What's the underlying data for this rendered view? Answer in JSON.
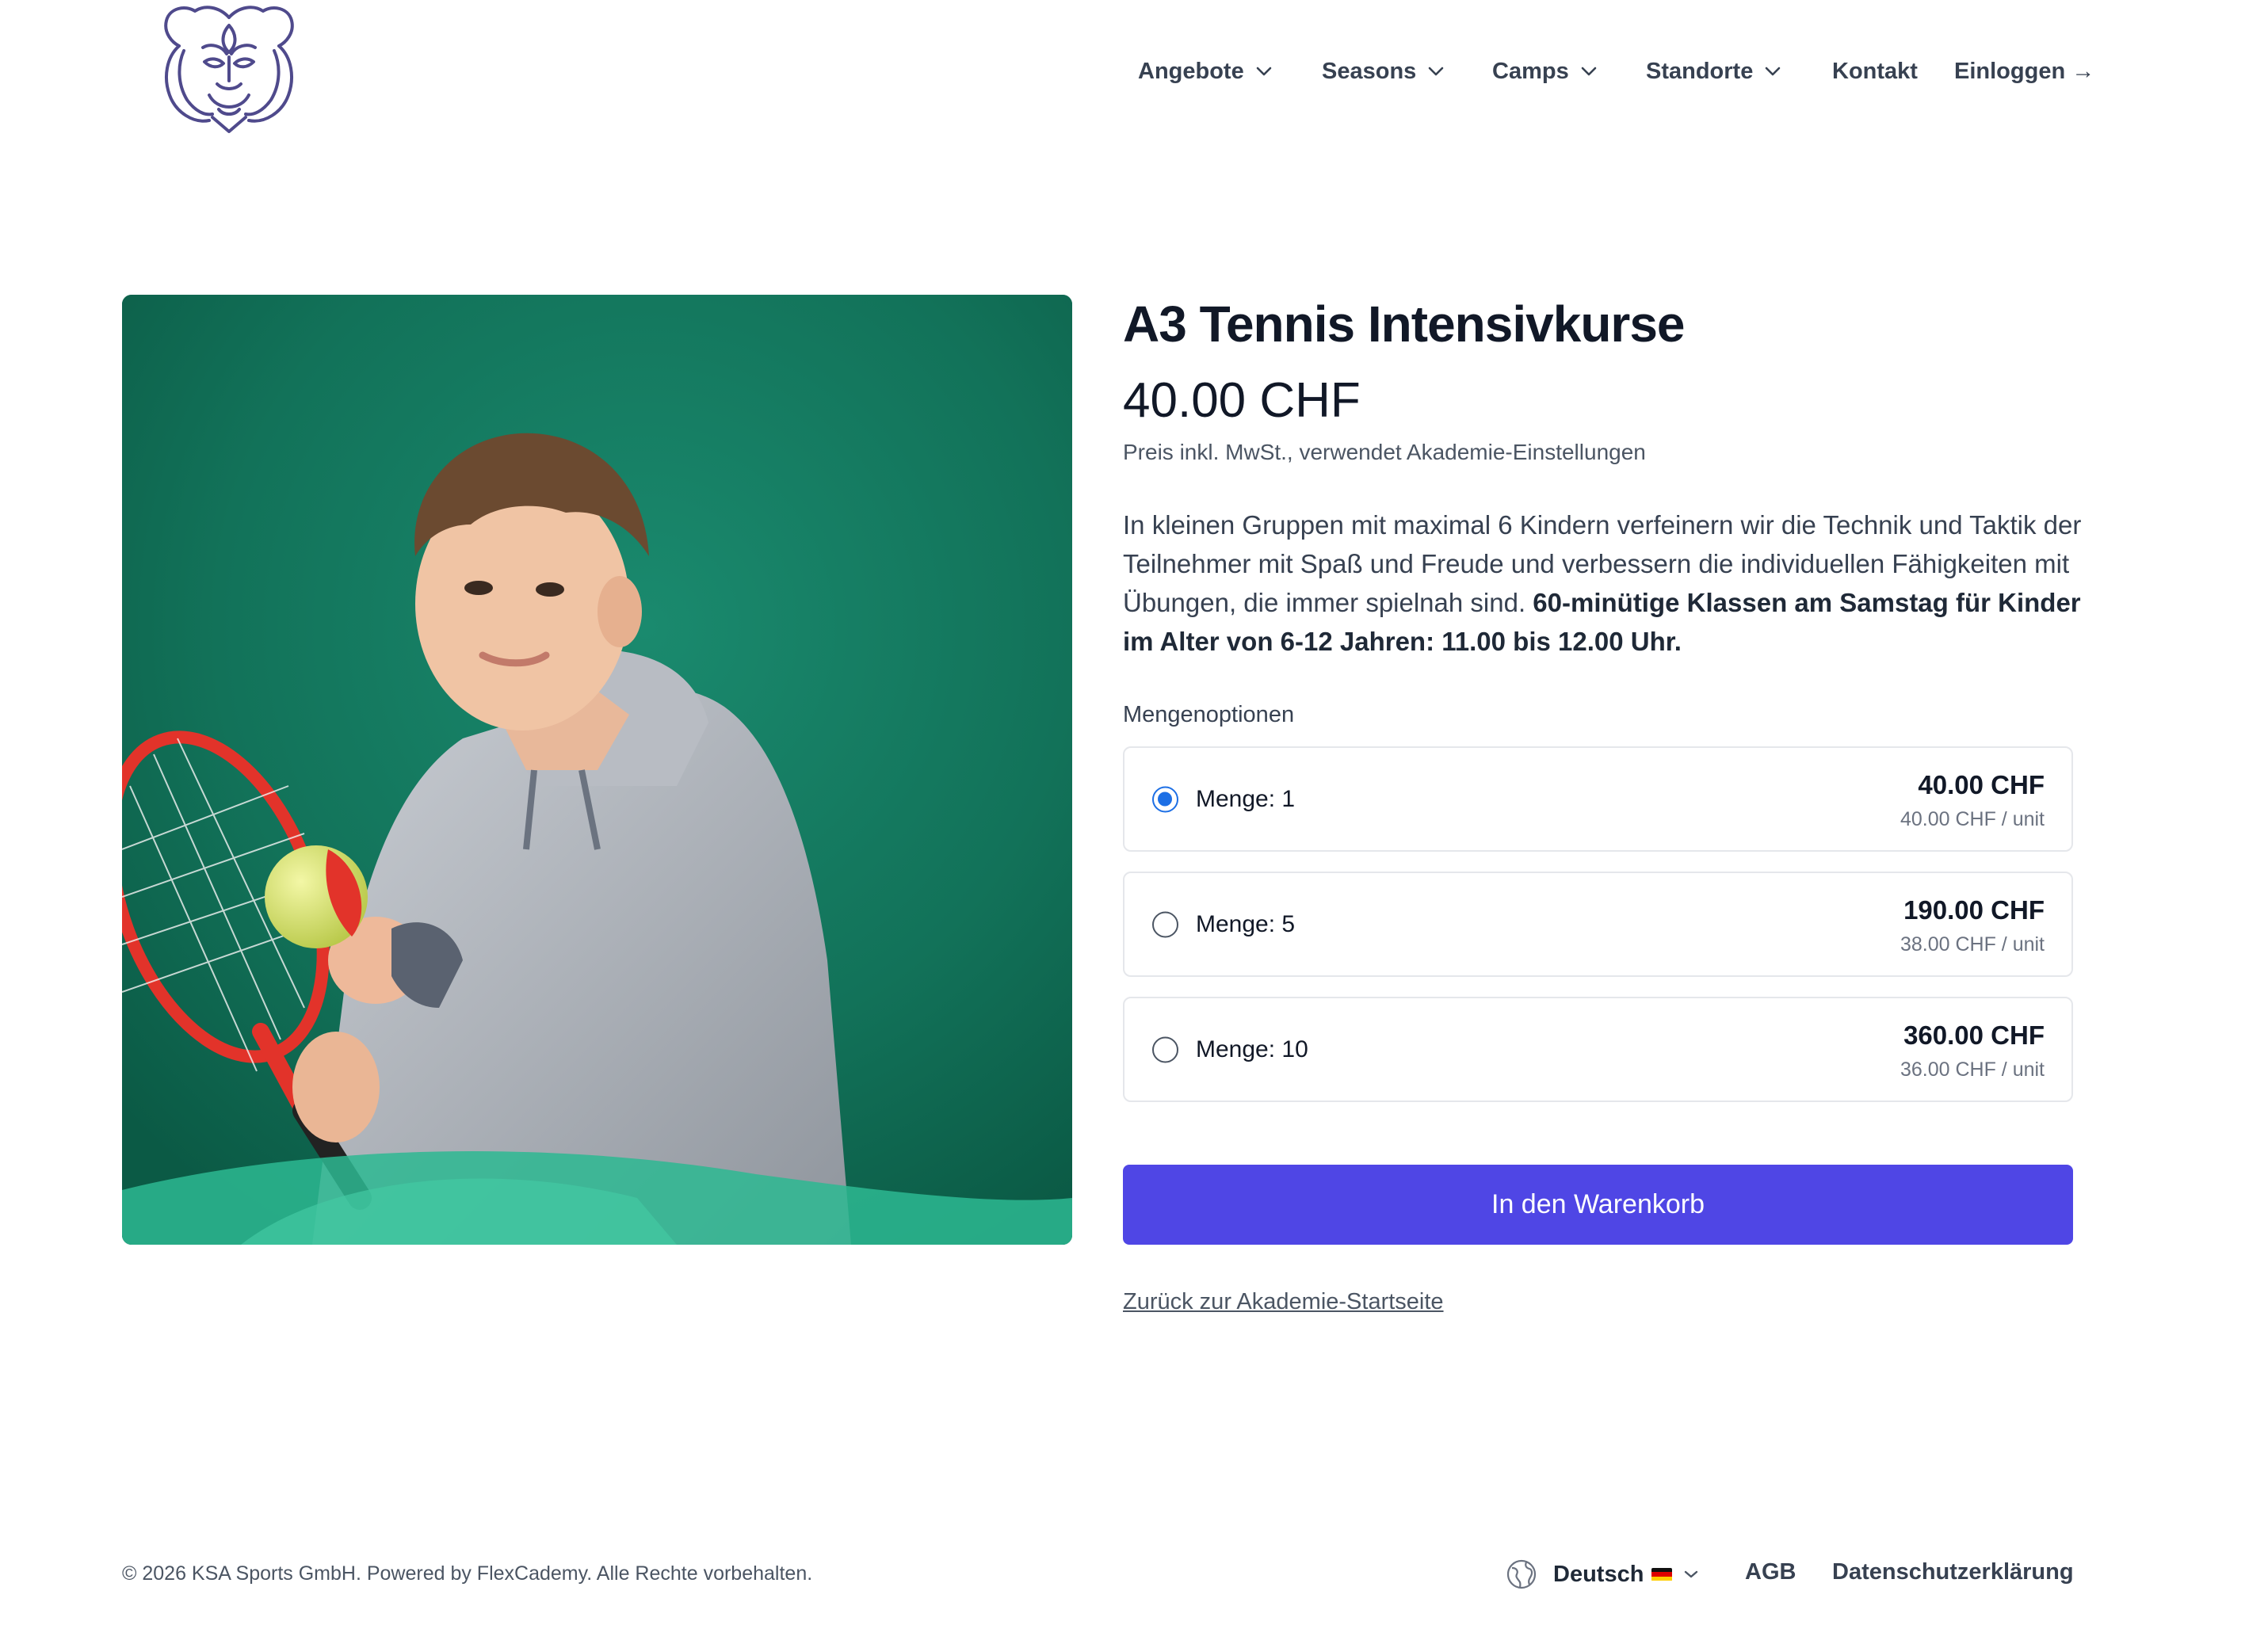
{
  "header": {
    "logo_icon": "lion-head-logo",
    "nav": [
      {
        "label": "Angebote",
        "dropdown": true
      },
      {
        "label": "Seasons",
        "dropdown": true
      },
      {
        "label": "Camps",
        "dropdown": true
      },
      {
        "label": "Standorte",
        "dropdown": true
      },
      {
        "label": "Kontakt",
        "dropdown": false
      },
      {
        "label": "Einloggen →",
        "dropdown": false
      }
    ]
  },
  "product": {
    "image_icon": "product-photo",
    "title": "A3 Tennis Intensivkurse",
    "price": "40.00 CHF",
    "price_note": "Preis inkl. MwSt., verwendet Akademie-Einstellungen",
    "description_plain": "In kleinen Gruppen mit maximal 6 Kindern verfeinern wir die Technik und Taktik der Teilnehmer mit Spaß und Freude und verbessern die individuellen Fähigkeiten mit Übungen, die immer spielnah sind. ",
    "description_bold": "60-minütige Klassen am Samstag für Kinder im Alter von 6-12 Jahren: 11.00 bis 12.00 Uhr."
  },
  "quantity": {
    "title": "Mengenoptionen",
    "options": [
      {
        "label": "Menge: 1",
        "total": "40.00 CHF",
        "unit": "40.00 CHF / unit",
        "selected": true
      },
      {
        "label": "Menge: 5",
        "total": "190.00 CHF",
        "unit": "38.00 CHF / unit",
        "selected": false
      },
      {
        "label": "Menge: 10",
        "total": "360.00 CHF",
        "unit": "36.00 CHF / unit",
        "selected": false
      }
    ]
  },
  "actions": {
    "add_to_cart": "In den Warenkorb",
    "back_link": "Zurück zur Akademie-Startseite"
  },
  "footer": {
    "copyright": "© 2026 KSA Sports GmbH. Powered by FlexCademy. Alle Rechte vorbehalten.",
    "language": "Deutsch",
    "language_icon": "globe-icon",
    "flag_icon": "german-flag-icon",
    "links": [
      "AGB",
      "Datenschutzerklärung"
    ]
  },
  "colors": {
    "accent": "#4f46e5",
    "radio_selected": "#1d6fe5",
    "logo": "#4f4a8c"
  }
}
